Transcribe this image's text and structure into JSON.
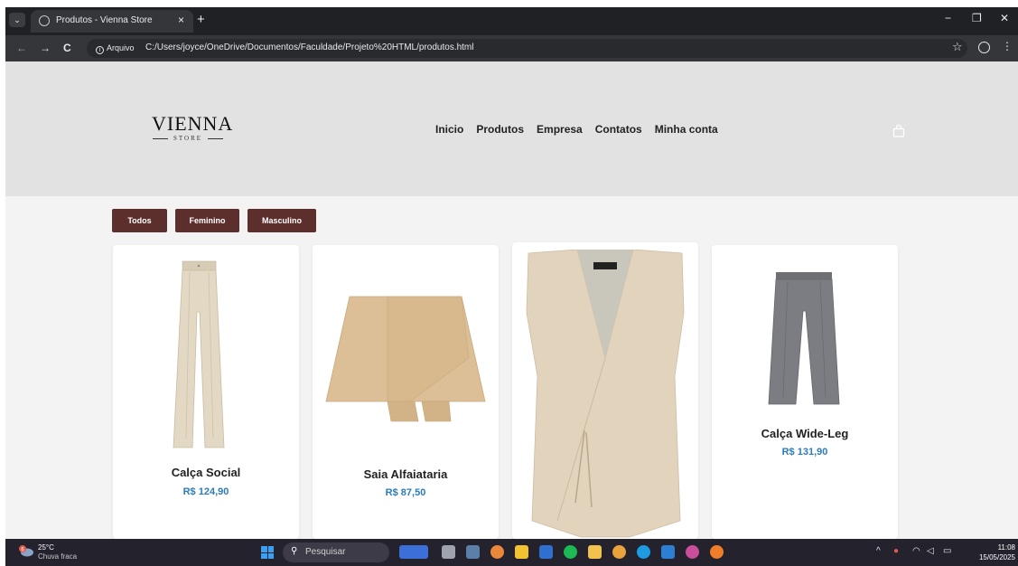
{
  "browser": {
    "tab_title": "Produtos - Vienna Store",
    "tab_close": "×",
    "new_tab": "+",
    "window_controls": {
      "minimize": "−",
      "restore": "❐",
      "close": "✕"
    },
    "nav": {
      "back": "←",
      "forward": "→",
      "reload": "C"
    },
    "security_chip": "Arquivo",
    "url": "C:/Users/joyce/OneDrive/Documentos/Faculdade/Projeto%20HTML/produtos.html",
    "icons": [
      "chevron-down-icon",
      "globe-icon",
      "info-icon",
      "star-icon",
      "profile-icon",
      "kebab-menu-icon"
    ]
  },
  "site": {
    "logo": {
      "main": "VIENNA",
      "sub": "STORE"
    },
    "nav": [
      "Inicio",
      "Produtos",
      "Empresa",
      "Contatos",
      "Minha conta"
    ],
    "cart_icon": "shopping-bag-icon"
  },
  "filters": [
    "Todos",
    "Feminino",
    "Masculino"
  ],
  "products": [
    {
      "name": "Calça Social",
      "price": "R$ 124,90",
      "image": "beige wide-leg pleated trousers"
    },
    {
      "name": "Saia Alfaiataria",
      "price": "R$ 87,50",
      "image": "beige tailored skort"
    },
    {
      "name": "",
      "price": "",
      "image": "beige wrap vest with side tie"
    },
    {
      "name": "Calça Wide-Leg",
      "price": "R$ 131,90",
      "image": "grey wide-leg trousers"
    }
  ],
  "taskbar": {
    "weather": {
      "temp": "25°C",
      "condition": "Chuva fraca",
      "badge": "6"
    },
    "search_placeholder": "Pesquisar",
    "time": "11:08",
    "date": "15/05/2025"
  },
  "colors": {
    "filter_button": "#5c2e2c",
    "price": "#2b7cbc",
    "header_bg": "#e2e2e2",
    "content_bg": "#f3f3f3"
  }
}
